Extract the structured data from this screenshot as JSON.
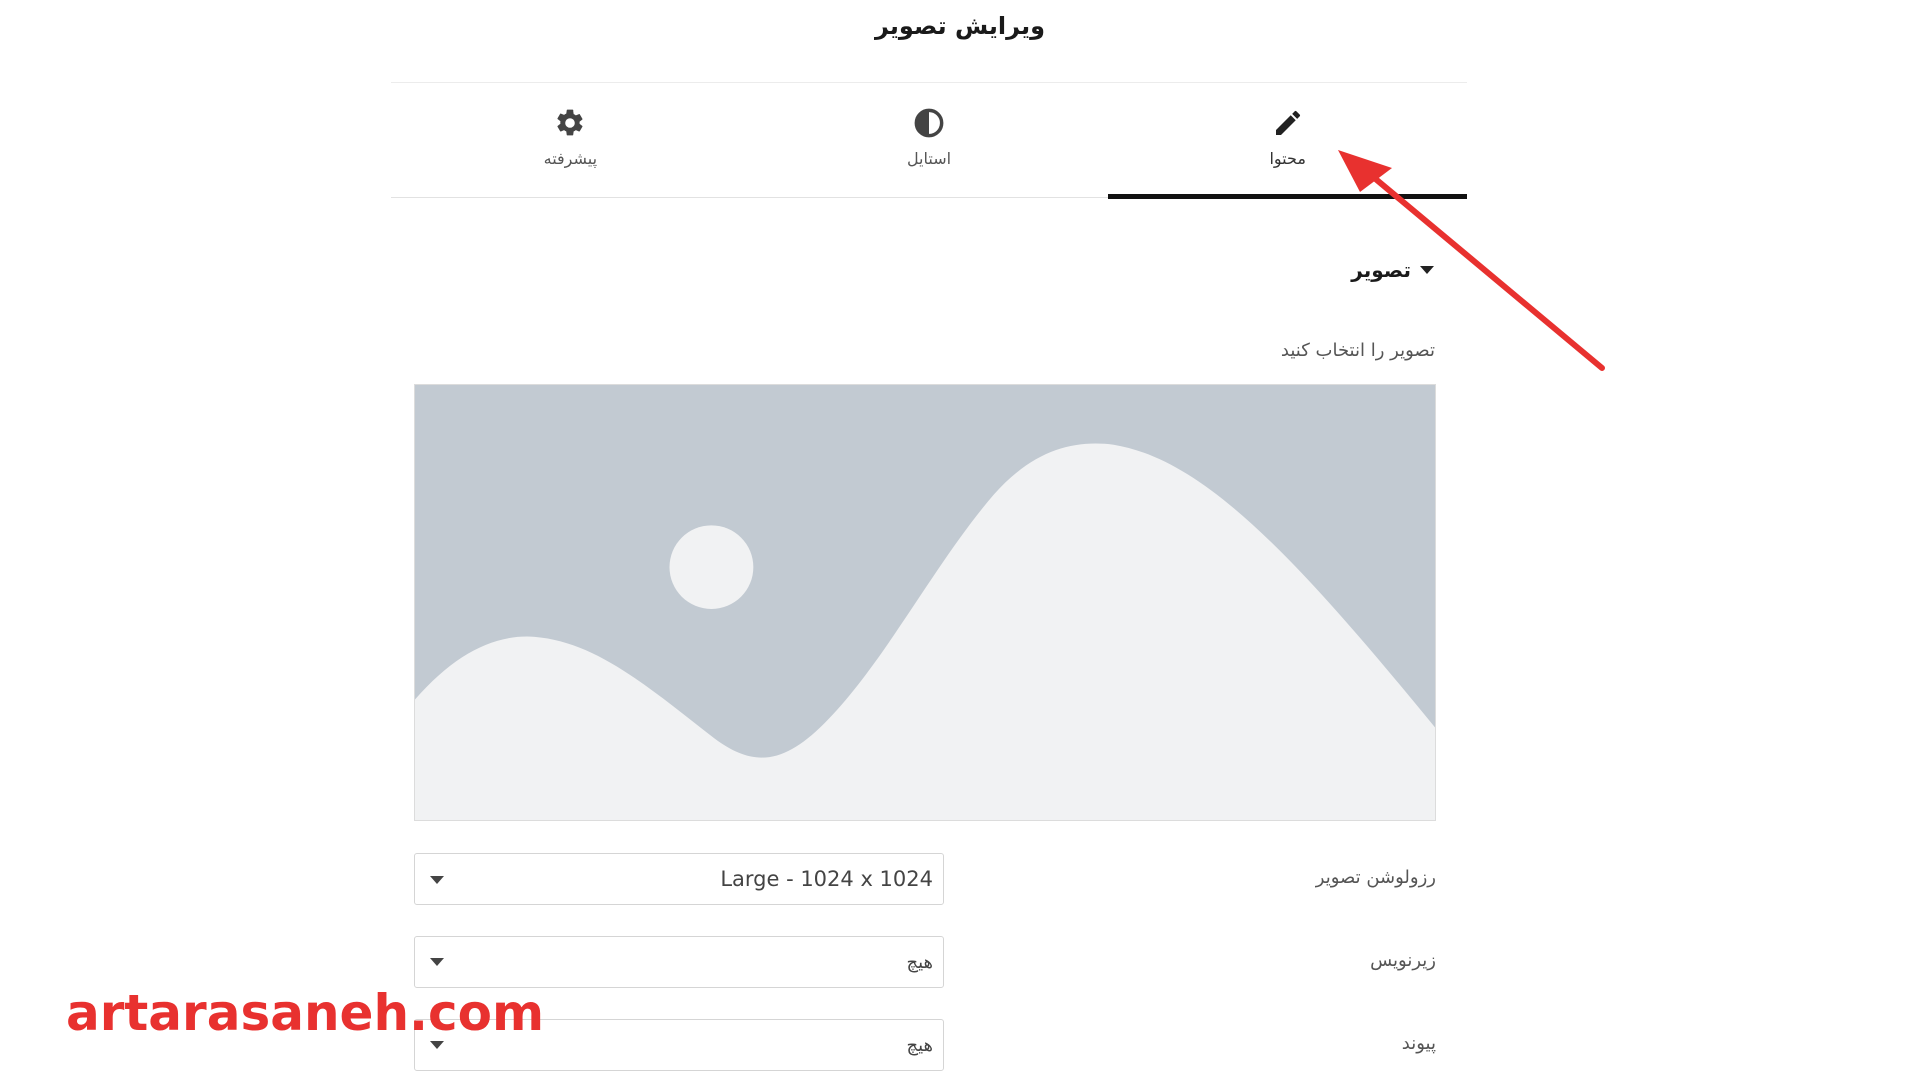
{
  "header": {
    "title": "ویرایش تصویر"
  },
  "tabs": [
    {
      "label": "پیشرفته",
      "icon": "gear-icon",
      "active": false
    },
    {
      "label": "استایل",
      "icon": "half-circle-contrast-icon",
      "active": false
    },
    {
      "label": "محتوا",
      "icon": "pencil-icon",
      "active": true
    }
  ],
  "section": {
    "heading": "تصویر",
    "choose_label": "تصویر را انتخاب کنید"
  },
  "image_placeholder": {
    "icon": "image-placeholder-icon",
    "colors": {
      "background": "#c2cad2",
      "foreground": "#f1f2f3"
    }
  },
  "fields": {
    "resolution": {
      "label": "رزولوشن تصویر",
      "value": "Large - 1024 x 1024"
    },
    "caption": {
      "label": "زیرنویس",
      "value": "هیچ"
    },
    "link": {
      "label": "پیوند",
      "value": "هیچ"
    }
  },
  "watermark": {
    "text": "artarasaneh.com",
    "color": "#e8312f"
  },
  "annotation": {
    "icon": "red-arrow-icon",
    "color": "#e8312f"
  }
}
